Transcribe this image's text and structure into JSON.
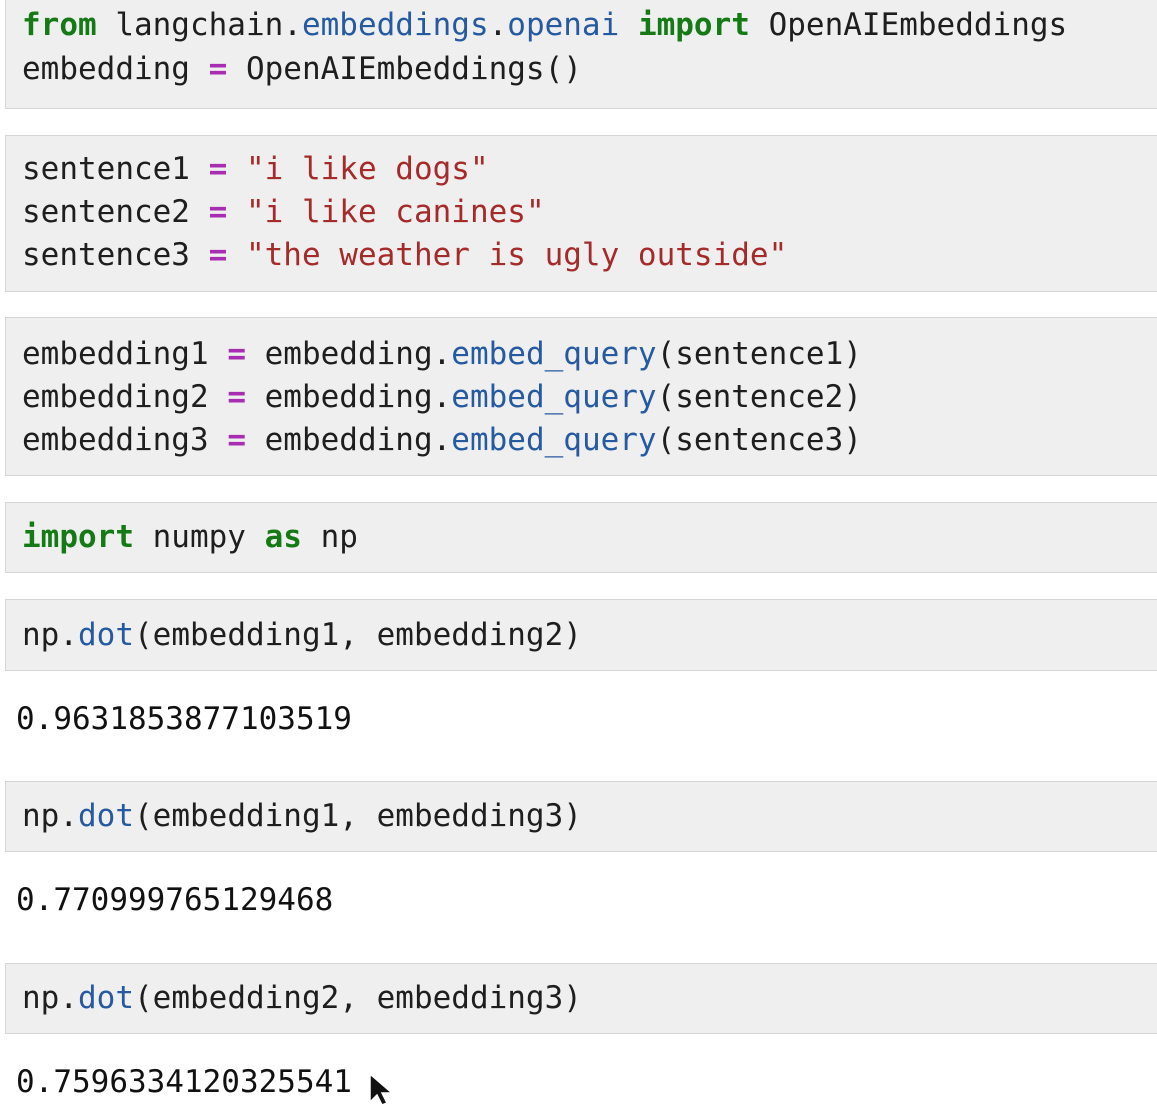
{
  "cells": [
    {
      "id": "import-embeddings",
      "lines": [
        [
          {
            "t": "from",
            "c": "kw"
          },
          {
            "t": " langchain",
            "c": ""
          },
          {
            "t": ".",
            "c": ""
          },
          {
            "t": "embeddings",
            "c": "mod"
          },
          {
            "t": ".",
            "c": ""
          },
          {
            "t": "openai",
            "c": "mod"
          },
          {
            "t": " ",
            "c": ""
          },
          {
            "t": "import",
            "c": "kw"
          },
          {
            "t": " OpenAIEmbeddings",
            "c": ""
          }
        ],
        [
          {
            "t": "embedding ",
            "c": ""
          },
          {
            "t": "=",
            "c": "op"
          },
          {
            "t": " OpenAIEmbeddings()",
            "c": ""
          }
        ]
      ]
    },
    {
      "id": "sentences",
      "lines": [
        [
          {
            "t": "sentence1 ",
            "c": ""
          },
          {
            "t": "=",
            "c": "op"
          },
          {
            "t": " ",
            "c": ""
          },
          {
            "t": "\"i like dogs\"",
            "c": "str"
          }
        ],
        [
          {
            "t": "sentence2 ",
            "c": ""
          },
          {
            "t": "=",
            "c": "op"
          },
          {
            "t": " ",
            "c": ""
          },
          {
            "t": "\"i like canines\"",
            "c": "str"
          }
        ],
        [
          {
            "t": "sentence3 ",
            "c": ""
          },
          {
            "t": "=",
            "c": "op"
          },
          {
            "t": " ",
            "c": ""
          },
          {
            "t": "\"the weather is ugly outside\"",
            "c": "str"
          }
        ]
      ]
    },
    {
      "id": "embed-queries",
      "lines": [
        [
          {
            "t": "embedding1 ",
            "c": ""
          },
          {
            "t": "=",
            "c": "op"
          },
          {
            "t": " embedding.",
            "c": ""
          },
          {
            "t": "embed_query",
            "c": "fn"
          },
          {
            "t": "(sentence1)",
            "c": ""
          }
        ],
        [
          {
            "t": "embedding2 ",
            "c": ""
          },
          {
            "t": "=",
            "c": "op"
          },
          {
            "t": " embedding.",
            "c": ""
          },
          {
            "t": "embed_query",
            "c": "fn"
          },
          {
            "t": "(sentence2)",
            "c": ""
          }
        ],
        [
          {
            "t": "embedding3 ",
            "c": ""
          },
          {
            "t": "=",
            "c": "op"
          },
          {
            "t": " embedding.",
            "c": ""
          },
          {
            "t": "embed_query",
            "c": "fn"
          },
          {
            "t": "(sentence3)",
            "c": ""
          }
        ]
      ]
    },
    {
      "id": "import-numpy",
      "lines": [
        [
          {
            "t": "import",
            "c": "kw"
          },
          {
            "t": " numpy ",
            "c": ""
          },
          {
            "t": "as",
            "c": "kw"
          },
          {
            "t": " np",
            "c": ""
          }
        ]
      ]
    },
    {
      "id": "dot-1-2",
      "lines": [
        [
          {
            "t": "np.",
            "c": ""
          },
          {
            "t": "dot",
            "c": "fn"
          },
          {
            "t": "(embedding1, embedding2)",
            "c": ""
          }
        ]
      ],
      "output": "0.9631853877103519"
    },
    {
      "id": "dot-1-3",
      "lines": [
        [
          {
            "t": "np.",
            "c": ""
          },
          {
            "t": "dot",
            "c": "fn"
          },
          {
            "t": "(embedding1, embedding3)",
            "c": ""
          }
        ]
      ],
      "output": "0.770999765129468"
    },
    {
      "id": "dot-2-3",
      "lines": [
        [
          {
            "t": "np.",
            "c": ""
          },
          {
            "t": "dot",
            "c": "fn"
          },
          {
            "t": "(embedding2, embedding3)",
            "c": ""
          }
        ]
      ],
      "output": "0.7596334120325541"
    }
  ]
}
